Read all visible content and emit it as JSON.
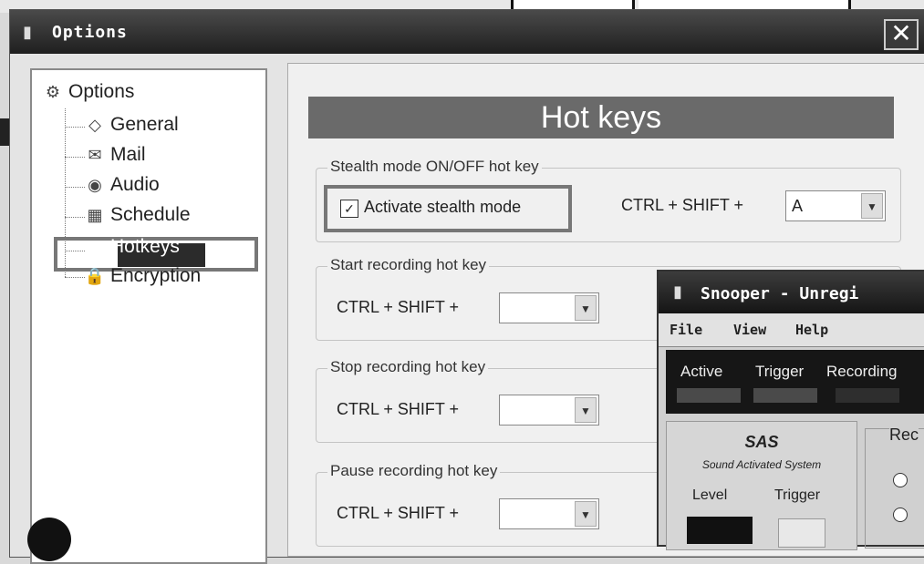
{
  "dialog": {
    "title": "Options",
    "close_glyph": "✕"
  },
  "tree": {
    "root": {
      "label": "Options",
      "icon": "options-icon"
    },
    "items": [
      {
        "label": "General",
        "icon": "general-icon"
      },
      {
        "label": "Mail",
        "icon": "mail-icon"
      },
      {
        "label": "Audio",
        "icon": "audio-icon"
      },
      {
        "label": "Schedule",
        "icon": "schedule-icon"
      },
      {
        "label": "Hotkeys",
        "icon": "hotkeys-icon",
        "selected": true
      },
      {
        "label": "Encryption",
        "icon": "encryption-icon"
      }
    ]
  },
  "panel": {
    "heading": "Hot keys",
    "groups": [
      {
        "title": "Stealth mode ON/OFF hot key",
        "checkbox_label": "Activate stealth mode",
        "checked": true,
        "modifier": "CTRL + SHIFT +",
        "key_value": "A"
      },
      {
        "title": "Start recording hot key",
        "modifier": "CTRL + SHIFT +",
        "key_value": ""
      },
      {
        "title": "Stop recording hot key",
        "modifier": "CTRL + SHIFT +",
        "key_value": ""
      },
      {
        "title": "Pause recording hot key",
        "modifier": "CTRL + SHIFT +",
        "key_value": ""
      }
    ]
  },
  "snooper": {
    "title": "Snooper - Unregi",
    "menu": [
      "File",
      "View",
      "Help"
    ],
    "status": [
      "Active",
      "Trigger",
      "Recording"
    ],
    "sas_title": "SAS",
    "sas_subtitle": "Sound Activated System",
    "level_label": "Level",
    "trigger_label": "Trigger",
    "rec_label": "Rec"
  }
}
